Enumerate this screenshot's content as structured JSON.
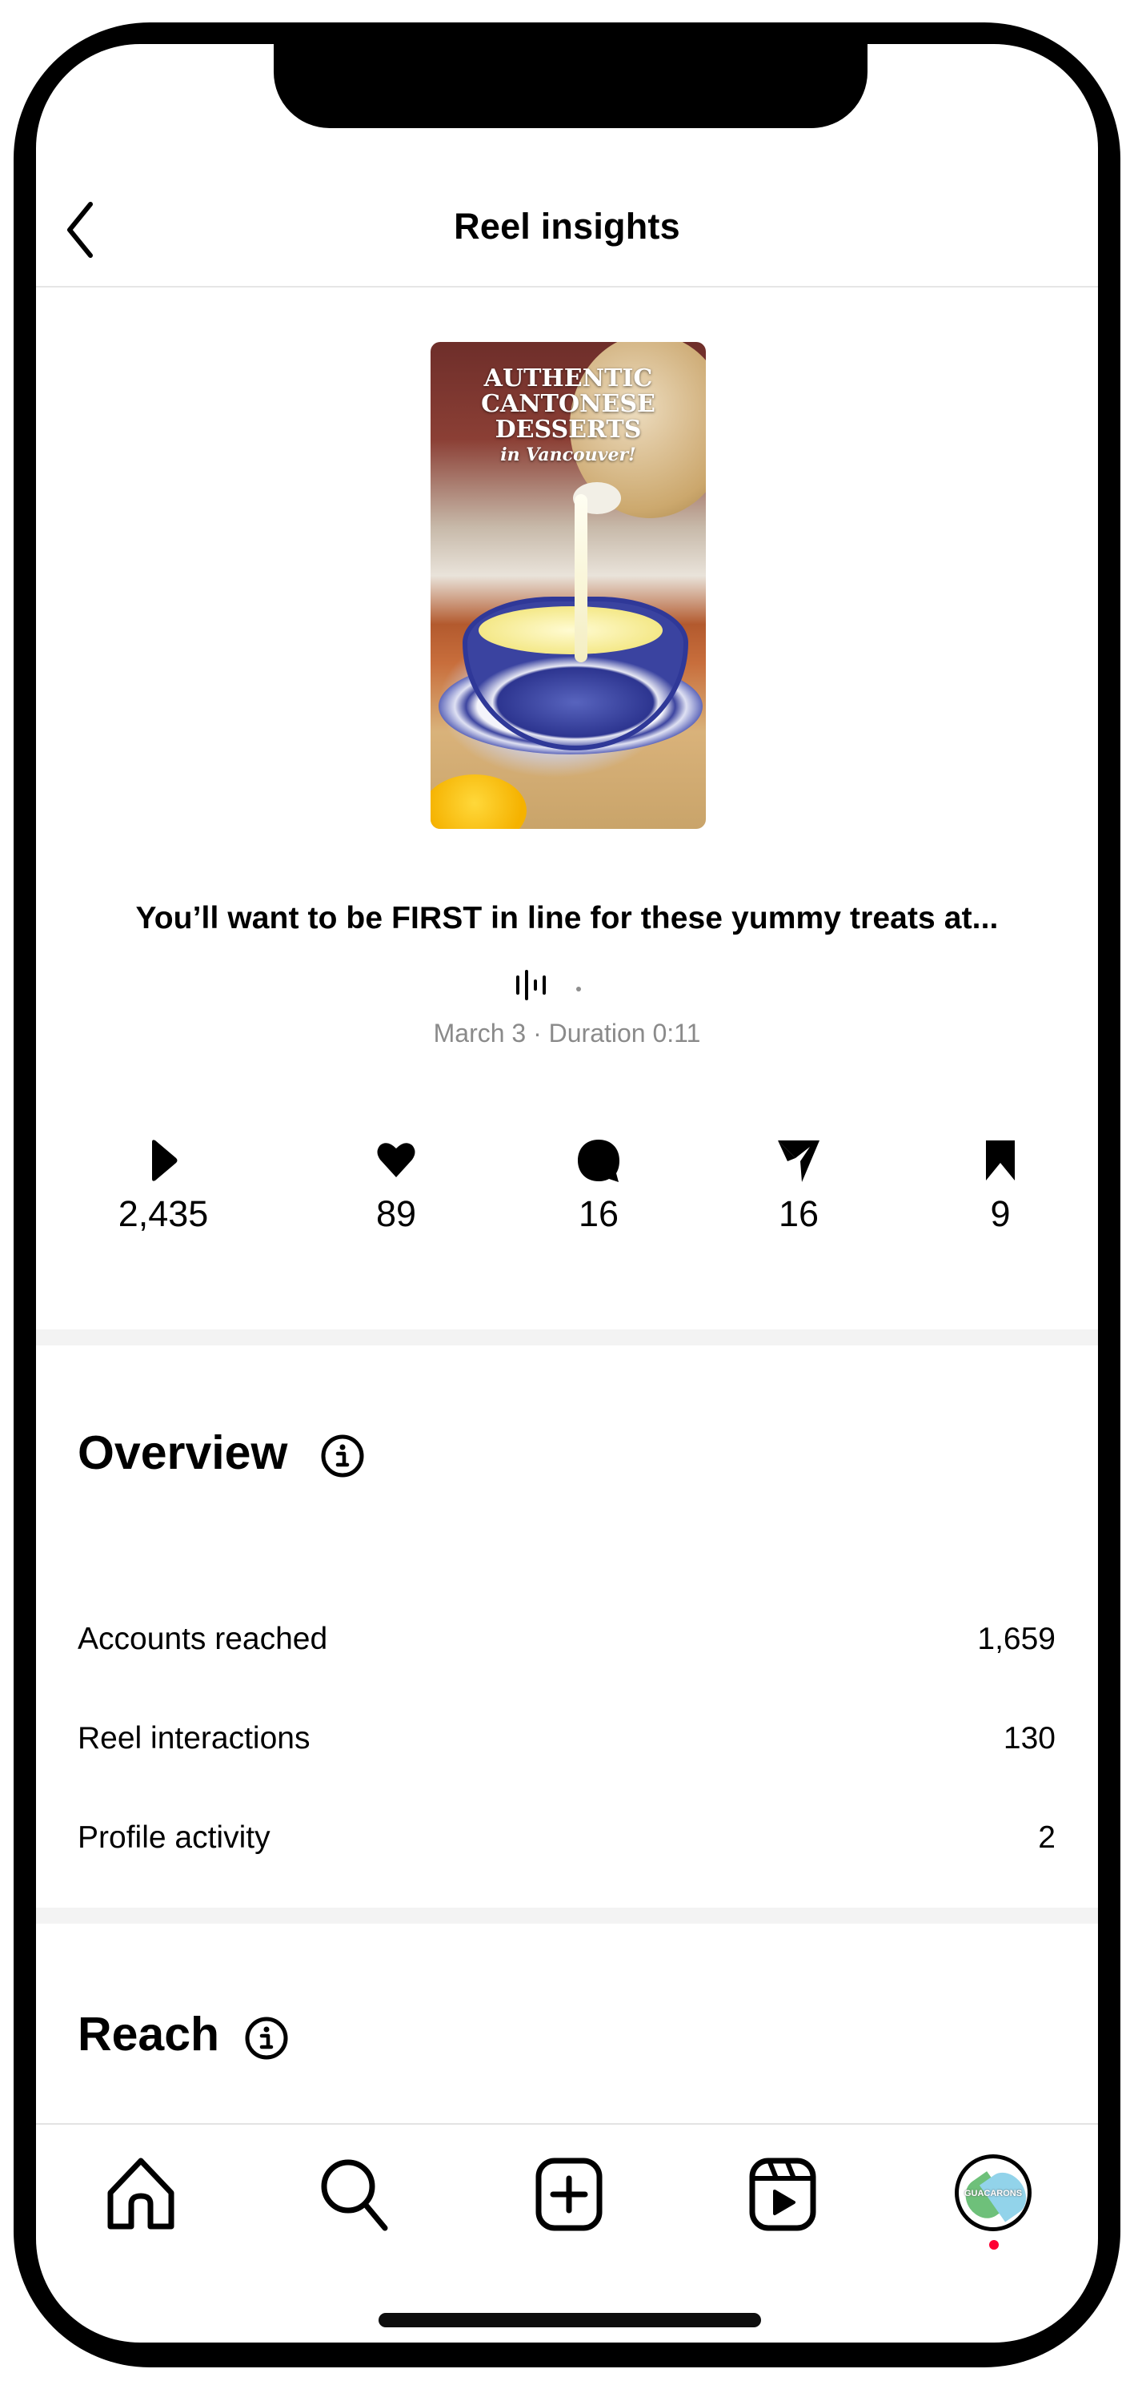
{
  "header": {
    "title": "Reel insights",
    "back_icon": "chevron-left-icon"
  },
  "reel": {
    "thumbnail_text": {
      "line1": "AUTHENTIC",
      "line2": "CANTONESE",
      "line3": "DESSERTS",
      "line4": "in Vancouver!"
    },
    "caption": "You’ll want to be FIRST in line for these yummy treats at...",
    "audio_icon": "audio-waveform-icon",
    "meta": "March 3 · Duration 0:11"
  },
  "stats": [
    {
      "icon": "play-icon",
      "value": "2,435",
      "name": "plays"
    },
    {
      "icon": "heart-icon",
      "value": "89",
      "name": "likes"
    },
    {
      "icon": "comment-icon",
      "value": "16",
      "name": "comments"
    },
    {
      "icon": "share-icon",
      "value": "16",
      "name": "shares"
    },
    {
      "icon": "bookmark-icon",
      "value": "9",
      "name": "saves"
    }
  ],
  "overview": {
    "title": "Overview",
    "rows": [
      {
        "label": "Accounts reached",
        "value": "1,659"
      },
      {
        "label": "Reel interactions",
        "value": "130"
      },
      {
        "label": "Profile activity",
        "value": "2"
      }
    ]
  },
  "reach": {
    "title": "Reach"
  },
  "nav": {
    "items": [
      "home",
      "search",
      "create",
      "reels",
      "profile"
    ],
    "avatar_text": "GUACARONS",
    "notification_color": "#ff0033"
  }
}
